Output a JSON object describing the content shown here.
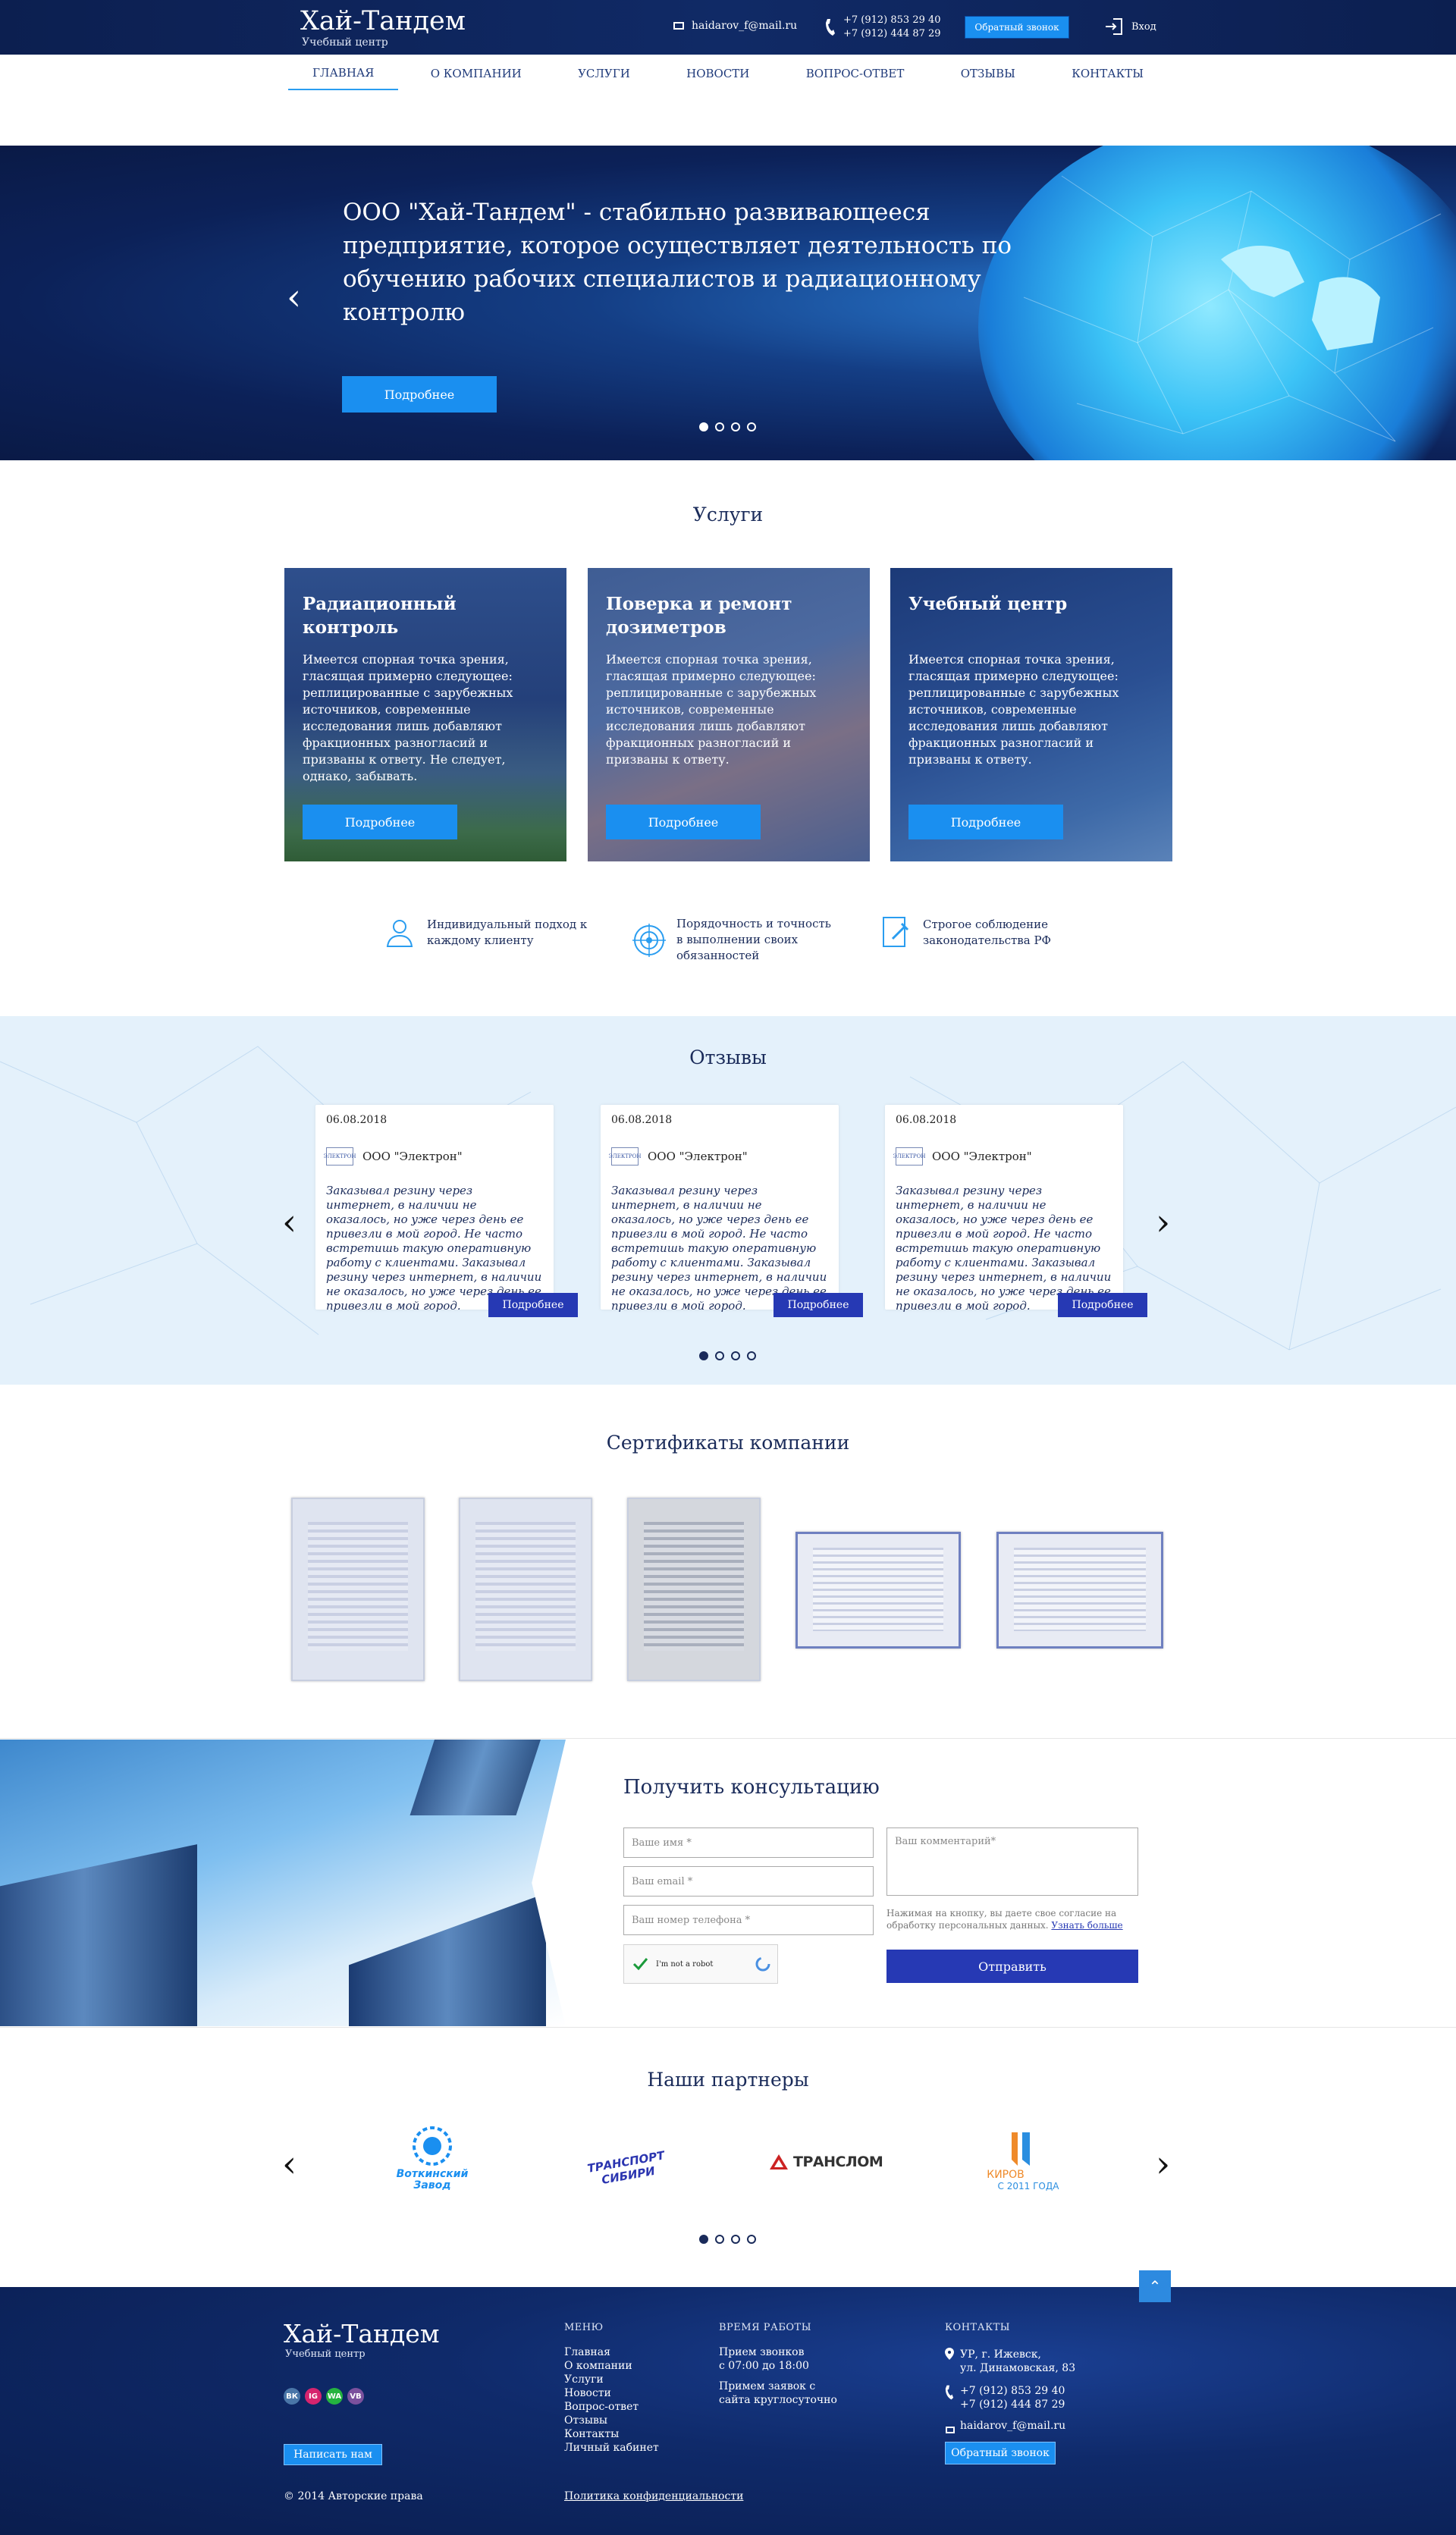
{
  "header": {
    "logo_title": "Хай-Тандем",
    "logo_subtitle": "Учебный центр",
    "email": "haidarov_f@mail.ru",
    "phone1": "+7 (912) 853 29 40",
    "phone2": "+7 (912) 444 87 29",
    "callback_btn": "Обратный звонок",
    "login": "Вход"
  },
  "nav": [
    "ГЛАВНАЯ",
    "О КОМПАНИИ",
    "УСЛУГИ",
    "НОВОСТИ",
    "ВОПРОС-ОТВЕТ",
    "ОТЗЫВЫ",
    "КОНТАКТЫ"
  ],
  "hero": {
    "title": "ООО \"Хай-Тандем\" - стабильно развивающееся предприятие, которое осуществляет деятельность по обучению рабочих специалистов и радиационному контролю",
    "button": "Подробнее"
  },
  "services": {
    "title": "Услуги",
    "cards": [
      {
        "title": "Радиационный контроль",
        "text": "Имеется спорная точка зрения, гласящая примерно следующее: реплицированные с зарубежных источников, современные исследования лишь добавляют фракционных разногласий и призваны к ответу. Не следует, однако, забывать.",
        "button": "Подробнее"
      },
      {
        "title": "Поверка и ремонт дозиметров",
        "text": "Имеется спорная точка зрения, гласящая примерно следующее: реплицированные с зарубежных источников, современные исследования лишь добавляют фракционных разногласий и призваны к ответу.",
        "button": "Подробнее"
      },
      {
        "title": "Учебный центр",
        "text": "Имеется спорная точка зрения, гласящая примерно следующее: реплицированные с зарубежных источников, современные исследования лишь добавляют фракционных разногласий и призваны к ответу.",
        "button": "Подробнее"
      }
    ]
  },
  "advantages": [
    "Индивидуальный подход к каждому клиенту",
    "Порядочность и точность в выполнении своих обязанностей",
    "Строгое соблюдение законодательства РФ"
  ],
  "reviews": {
    "title": "Отзывы",
    "items": [
      {
        "date": "06.08.2018",
        "company": "ООО \"Электрон\"",
        "text": "Заказывал резину через интернет, в наличии не оказалось, но уже через день ее привезли в мой город. Не часто встретишь такую оперативную работу с клиентами. Заказывал резину через интернет, в наличии не оказалось, но уже через день ее привезли в мой город.",
        "button": "Подробнее"
      },
      {
        "date": "06.08.2018",
        "company": "ООО \"Электрон\"",
        "text": "Заказывал резину через интернет, в наличии не оказалось, но уже через день ее привезли в мой город. Не часто встретишь такую оперативную работу с клиентами. Заказывал резину через интернет, в наличии не оказалось, но уже через день ее привезли в мой город.",
        "button": "Подробнее"
      },
      {
        "date": "06.08.2018",
        "company": "ООО \"Электрон\"",
        "text": "Заказывал резину через интернет, в наличии не оказалось, но уже через день ее привезли в мой город. Не часто встретишь такую оперативную работу с клиентами. Заказывал резину через интернет, в наличии не оказалось, но уже через день ее привезли в мой город.",
        "button": "Подробнее"
      }
    ]
  },
  "certificates": {
    "title": "Сертификаты компании"
  },
  "consult": {
    "title": "Получить консультацию",
    "name_ph": "Ваше имя *",
    "email_ph": "Ваш email *",
    "phone_ph": "Ваш номер телефона *",
    "comment_ph": "Ваш комментарий*",
    "captcha": "I'm not a robot",
    "agree": "Нажимая на кнопку, вы даете свое согласие на обработку персональных данных.",
    "agree_link": "Узнать больше",
    "submit": "Отправить"
  },
  "partners": {
    "title": "Наши партнеры",
    "items": [
      "Воткинский Завод",
      "ТРАНСПОРТ СИБИРИ",
      "ТРАНСЛОМ",
      "КИРОВ",
      "С 2011 ГОДА"
    ]
  },
  "footer": {
    "logo_title": "Хай-Тандем",
    "logo_subtitle": "Учебный центр",
    "write_btn": "Написать нам",
    "copyright": "© 2014 Авторские права",
    "menu_title": "МЕНЮ",
    "menu": [
      "Главная",
      "О компании",
      "Услуги",
      "Новости",
      "Вопрос-ответ",
      "Отзывы",
      "Контакты",
      "Личный кабинет"
    ],
    "privacy": "Политика конфиденциальности",
    "hours_title": "ВРЕМЯ РАБОТЫ",
    "hours1": "Прием звонков",
    "hours2": "с 07:00 до 18:00",
    "hours3": "Примем заявок с",
    "hours4": "сайта круглосуточно",
    "contacts_title": "КОНТАКТЫ",
    "addr1": "УР, г. Ижевск,",
    "addr2": "ул. Динамовская, 83",
    "phone1": "+7 (912) 853 29 40",
    "phone2": "+7 (912) 444 87 29",
    "email": "haidarov_f@mail.ru",
    "callback_btn": "Обратный звонок"
  },
  "social": [
    "ВК",
    "IG",
    "WA",
    "VB"
  ],
  "colors": {
    "navy": "#0c1f50",
    "accent": "#1a8ff0",
    "button_dark": "#2639b4",
    "review_bg": "#e4f1fb"
  }
}
